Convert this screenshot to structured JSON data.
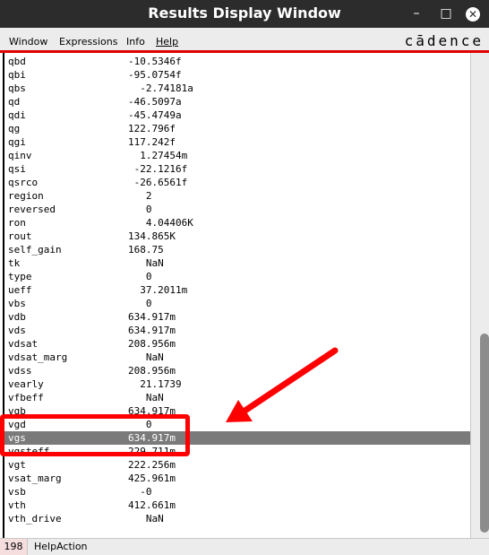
{
  "window": {
    "title": "Results Display Window",
    "minimize": "–",
    "maximize": "□",
    "close": "✕"
  },
  "menu": {
    "items": [
      "Window",
      "Expressions",
      "Info",
      "Help"
    ],
    "logo": "cādence"
  },
  "rows": [
    {
      "k": "qbd",
      "v": "-10.5346f"
    },
    {
      "k": "qbi",
      "v": "-95.0754f"
    },
    {
      "k": "qbs",
      "v": "  -2.74181a"
    },
    {
      "k": "qd",
      "v": "-46.5097a"
    },
    {
      "k": "qdi",
      "v": "-45.4749a"
    },
    {
      "k": "qg",
      "v": "122.796f"
    },
    {
      "k": "qgi",
      "v": "117.242f"
    },
    {
      "k": "qinv",
      "v": "  1.27454m"
    },
    {
      "k": "qsi",
      "v": " -22.1216f"
    },
    {
      "k": "qsrco",
      "v": " -26.6561f"
    },
    {
      "k": "region",
      "v": "   2"
    },
    {
      "k": "reversed",
      "v": "   0"
    },
    {
      "k": "ron",
      "v": "   4.04406K"
    },
    {
      "k": "rout",
      "v": "134.865K"
    },
    {
      "k": "self_gain",
      "v": "168.75"
    },
    {
      "k": "tk",
      "v": "   NaN"
    },
    {
      "k": "type",
      "v": "   0"
    },
    {
      "k": "ueff",
      "v": "  37.2011m"
    },
    {
      "k": "vbs",
      "v": "   0"
    },
    {
      "k": "vdb",
      "v": "634.917m"
    },
    {
      "k": "vds",
      "v": "634.917m"
    },
    {
      "k": "vdsat",
      "v": "208.956m"
    },
    {
      "k": "vdsat_marg",
      "v": "   NaN"
    },
    {
      "k": "vdss",
      "v": "208.956m"
    },
    {
      "k": "vearly",
      "v": "  21.1739"
    },
    {
      "k": "vfbeff",
      "v": "   NaN"
    },
    {
      "k": "vgb",
      "v": "634.917m"
    },
    {
      "k": "vgd",
      "v": "   0"
    },
    {
      "k": "vgs",
      "v": "634.917m"
    },
    {
      "k": "vgsteff",
      "v": "229.711m"
    },
    {
      "k": "vgt",
      "v": "222.256m"
    },
    {
      "k": "vsat_marg",
      "v": "425.961m"
    },
    {
      "k": "vsb",
      "v": "  -0"
    },
    {
      "k": "vth",
      "v": "412.661m"
    },
    {
      "k": "vth_drive",
      "v": "   NaN"
    }
  ],
  "selected_row": "vgs",
  "status": {
    "number": "198",
    "text": "HelpAction"
  },
  "colors": {
    "accent": "#e00000",
    "annotation": "#ff0000",
    "selection": "#7a7a7a"
  },
  "icons": [
    "minimize-icon",
    "maximize-icon",
    "close-icon"
  ]
}
